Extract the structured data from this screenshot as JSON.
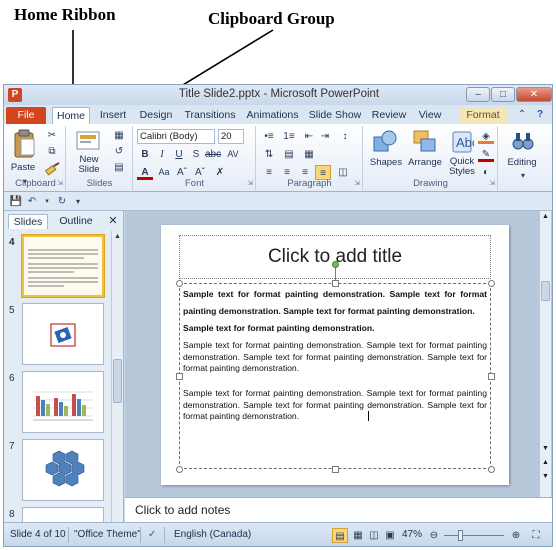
{
  "annotations": {
    "home_ribbon": "Home Ribbon",
    "clipboard_group": "Clipboard Group"
  },
  "window": {
    "title": "Title Slide2.pptx - Microsoft PowerPoint",
    "app_icon": "P"
  },
  "tabs": [
    "File",
    "Home",
    "Insert",
    "Design",
    "Transitions",
    "Animations",
    "Slide Show",
    "Review",
    "View",
    "Format"
  ],
  "ribbon": {
    "clipboard": {
      "label": "Clipboard",
      "paste": "Paste"
    },
    "slides": {
      "label": "Slides",
      "new_slide_line1": "New",
      "new_slide_line2": "Slide"
    },
    "font": {
      "label": "Font",
      "font_name": "Calibri (Body)",
      "font_size": "20"
    },
    "paragraph": {
      "label": "Paragraph"
    },
    "drawing": {
      "label": "Drawing",
      "shapes": "Shapes",
      "arrange": "Arrange",
      "quick_styles_line1": "Quick",
      "quick_styles_line2": "Styles"
    },
    "editing": {
      "label": "Editing"
    }
  },
  "pane": {
    "tab_slides": "Slides",
    "tab_outline": "Outline",
    "thumb_numbers": [
      "4",
      "5",
      "6",
      "7",
      "8"
    ]
  },
  "slide": {
    "title_placeholder": "Click to add title",
    "bold_text_1": "Sample text for format painting demonstration. Sample text for format painting demonstration. Sample text for format painting demonstration.",
    "bold_text_2": "Sample text for format painting demonstration.",
    "normal_text_1": "Sample text for format painting demonstration. Sample text for format painting demonstration. Sample text for format painting demonstration. Sample text for format painting demonstration.",
    "normal_text_2": "Sample text for format painting demonstration. Sample text for format painting demonstration. Sample text for format painting demonstration. Sample text for format painting demonstration."
  },
  "notes_placeholder": "Click to add notes",
  "status": {
    "slide_info": "Slide 4 of 10",
    "theme": "\"Office Theme\"",
    "language": "English (Canada)",
    "zoom": "47%"
  }
}
